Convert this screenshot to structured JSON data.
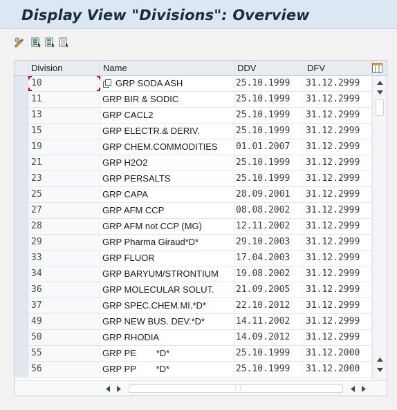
{
  "window": {
    "title": "Display View \"Divisions\": Overview"
  },
  "toolbar": {
    "buttons": [
      {
        "name": "display-change-toggle-icon"
      },
      {
        "name": "select-all-icon"
      },
      {
        "name": "select-block-icon"
      },
      {
        "name": "deselect-all-icon"
      }
    ]
  },
  "table": {
    "columns": [
      "Division",
      "Name",
      "DDV",
      "DFV"
    ],
    "rows": [
      {
        "division": "10",
        "name": "GRP SODA ASH",
        "ddv": "25.10.1999",
        "dfv": "31.12.2999"
      },
      {
        "division": "11",
        "name": "GRP BIR & SODIC",
        "ddv": "25.10.1999",
        "dfv": "31.12.2999"
      },
      {
        "division": "13",
        "name": "GRP CACL2",
        "ddv": "25.10.1999",
        "dfv": "31.12.2999"
      },
      {
        "division": "15",
        "name": "GRP ELECTR.& DERIV.",
        "ddv": "25.10.1999",
        "dfv": "31.12.2999"
      },
      {
        "division": "19",
        "name": "GRP CHEM.COMMODITIES",
        "ddv": "01.01.2007",
        "dfv": "31.12.2999"
      },
      {
        "division": "21",
        "name": "GRP H2O2",
        "ddv": "25.10.1999",
        "dfv": "31.12.2999"
      },
      {
        "division": "23",
        "name": "GRP PERSALTS",
        "ddv": "25.10.1999",
        "dfv": "31.12.2999"
      },
      {
        "division": "25",
        "name": "GRP CAPA",
        "ddv": "28.09.2001",
        "dfv": "31.12.2999"
      },
      {
        "division": "27",
        "name": "GRP AFM CCP",
        "ddv": "08.08.2002",
        "dfv": "31.12.2999"
      },
      {
        "division": "28",
        "name": "GRP AFM not CCP (MG)",
        "ddv": "12.11.2002",
        "dfv": "31.12.2999"
      },
      {
        "division": "29",
        "name": "GRP Pharma Giraud*D*",
        "ddv": "29.10.2003",
        "dfv": "31.12.2999"
      },
      {
        "division": "33",
        "name": "GRP FLUOR",
        "ddv": "17.04.2003",
        "dfv": "31.12.2999"
      },
      {
        "division": "34",
        "name": "GRP BARYUM/STRONTIUM",
        "ddv": "19.08.2002",
        "dfv": "31.12.2999"
      },
      {
        "division": "36",
        "name": "GRP MOLECULAR SOLUT.",
        "ddv": "21.09.2005",
        "dfv": "31.12.2999"
      },
      {
        "division": "37",
        "name": "GRP SPEC.CHEM.MI.*D*",
        "ddv": "22.10.2012",
        "dfv": "31.12.2999"
      },
      {
        "division": "49",
        "name": "GRP NEW BUS. DEV.*D*",
        "ddv": "14.11.2002",
        "dfv": "31.12.2999"
      },
      {
        "division": "50",
        "name": "GRP RHODIA",
        "ddv": "14.09.2012",
        "dfv": "31.12.2999"
      },
      {
        "division": "55",
        "name": "GRP PE        *D*",
        "ddv": "25.10.1999",
        "dfv": "31.12.2000"
      },
      {
        "division": "56",
        "name": "GRP PP        *D*",
        "ddv": "25.10.1999",
        "dfv": "31.12.2000"
      }
    ]
  },
  "colors": {
    "title_bg": "#dbe7f3",
    "header_bg": "#e8edf2",
    "focus": "#d0021b"
  }
}
